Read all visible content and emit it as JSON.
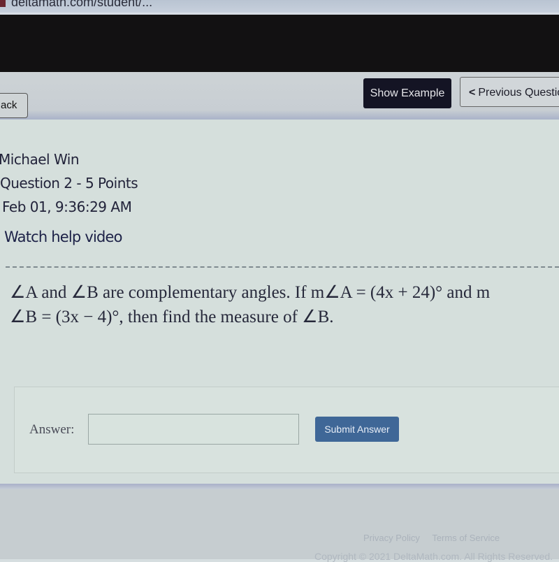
{
  "browser": {
    "url_text": "deltamath.com/student/..."
  },
  "toolbar": {
    "back_label": "ack",
    "show_example_label": "Show Example",
    "previous_question_label": "Previous Questio",
    "chevron_left_glyph": "<"
  },
  "student": {
    "name": "Michael Win",
    "question_info": "Question 2 - 5 Points",
    "timestamp": "Feb 01, 9:36:29 AM",
    "help_video_link": "Watch help video"
  },
  "question": {
    "line1": "∠A and ∠B are complementary angles. If m∠A = (4x + 24)° and m",
    "line2": "∠B = (3x − 4)°, then find the measure of ∠B."
  },
  "answer": {
    "label": "Answer:",
    "value": "",
    "placeholder": "",
    "submit_label": "Submit Answer"
  },
  "footer": {
    "privacy_policy": "Privacy Policy",
    "terms_of_service": "Terms of Service",
    "copyright": "Copyright © 2021 DeltaMath.com. All Rights Reserved."
  },
  "colors": {
    "show_example_bg": "#141424",
    "submit_bg": "#3f6797",
    "page_bg": "#d5dfdc"
  }
}
